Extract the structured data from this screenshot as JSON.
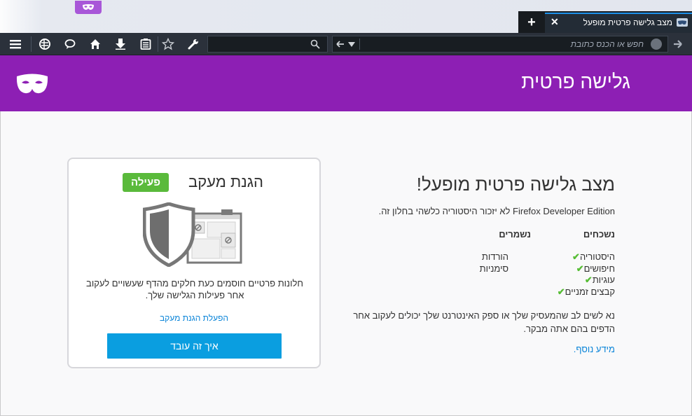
{
  "browser": {
    "tab": {
      "title": "מצב גלישה פרטית מופעל",
      "close_glyph": "✕",
      "icon": "private-mask-icon"
    },
    "new_tab_glyph": "+",
    "urlbar": {
      "placeholder": "חפש או הכנס כתובת"
    },
    "toolbar_icons": [
      "menu-icon",
      "developer-icon",
      "chat-icon",
      "home-icon",
      "download-icon",
      "reading-list-icon",
      "bookmark-star-icon",
      "wrench-icon",
      "search-icon",
      "back-icon",
      "forward-icon",
      "globe-icon"
    ]
  },
  "header": {
    "title": "גלישה פרטית",
    "accent": "#8d1fb4"
  },
  "main": {
    "heading": "מצב גלישה פרטית מופעל!",
    "description": "Firefox Developer Edition לא יזכור היסטוריה כלשהי בחלון זה.",
    "forgotten_header": "נשכחים",
    "kept_header": "נשמרים",
    "forgotten": [
      "היסטוריה",
      "חיפושים",
      "עוגיות",
      "קבצים זמניים"
    ],
    "kept": [
      "הורדות",
      "סימניות"
    ],
    "note": "נא לשים לב שהמעסיק שלך או ספק האינטרנט שלך יכולים לעקוב אחר הדפים בהם אתה מבקר.",
    "more_link": "מידע נוסף."
  },
  "tracking": {
    "title": "הגנת מעקב",
    "badge": "פעילה",
    "badge_color": "#5aba3b",
    "text": "חלונות פרטיים חוסמים כעת חלקים מהדף שעשויים לעקוב אחר פעילות הגלישה שלך.",
    "link": "הפעלת הגנת מעקב",
    "button": "איך זה עובד",
    "button_color": "#0a9ee0"
  }
}
